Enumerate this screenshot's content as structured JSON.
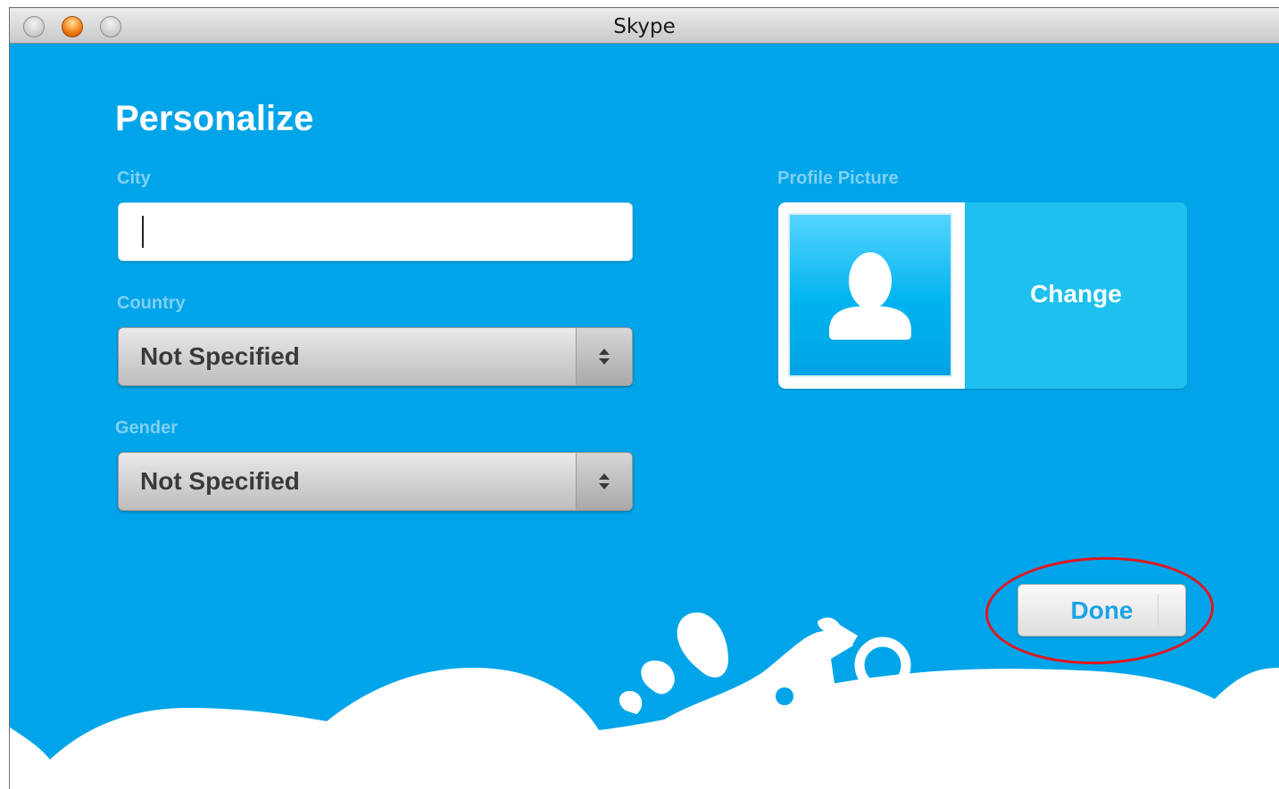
{
  "window": {
    "title": "Skype"
  },
  "page": {
    "heading": "Personalize"
  },
  "form": {
    "city": {
      "label": "City",
      "value": ""
    },
    "country": {
      "label": "Country",
      "value": "Not Specified"
    },
    "gender": {
      "label": "Gender",
      "value": "Not Specified"
    }
  },
  "profile_picture": {
    "label": "Profile Picture",
    "change_label": "Change"
  },
  "actions": {
    "done_label": "Done"
  },
  "icons": {
    "close": "close-dot-icon",
    "minimize": "minimize-dot-icon",
    "zoom": "zoom-dot-icon",
    "avatar": "user-silhouette-icon",
    "select_arrows": "up-down-arrows-icon",
    "decoration": "motorbike-illustration"
  },
  "colors": {
    "background_blue": "#00a5e9",
    "label_blue": "#7fd0f4",
    "done_text": "#1ba4e6",
    "annotation_red": "#e1161f"
  }
}
